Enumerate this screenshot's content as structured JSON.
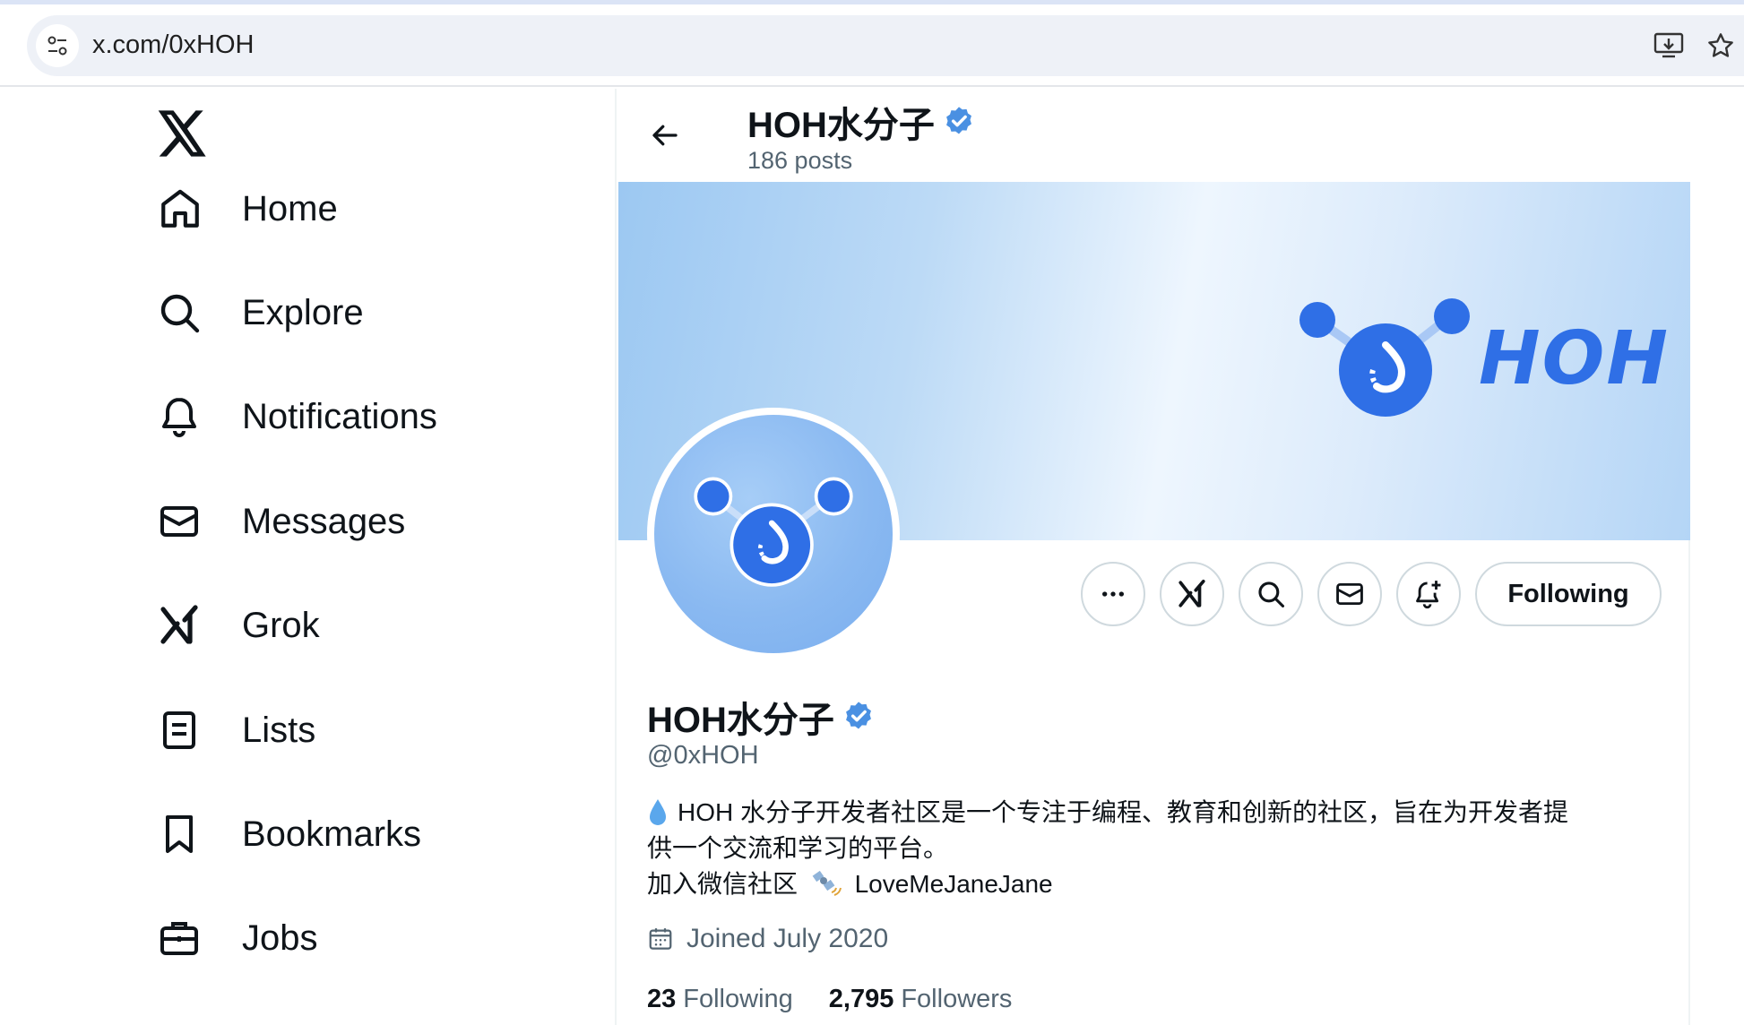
{
  "browser": {
    "url": "x.com/0xHOH"
  },
  "sidebar": {
    "items": [
      {
        "label": "Home",
        "icon": "home-icon"
      },
      {
        "label": "Explore",
        "icon": "search-icon"
      },
      {
        "label": "Notifications",
        "icon": "bell-icon"
      },
      {
        "label": "Messages",
        "icon": "mail-icon"
      },
      {
        "label": "Grok",
        "icon": "grok-icon"
      },
      {
        "label": "Lists",
        "icon": "list-icon"
      },
      {
        "label": "Bookmarks",
        "icon": "bookmark-icon"
      },
      {
        "label": "Jobs",
        "icon": "briefcase-icon"
      }
    ]
  },
  "header": {
    "name": "HOH水分子",
    "posts": "186 posts"
  },
  "banner": {
    "wordmark": "HOH"
  },
  "actions": {
    "following_label": "Following"
  },
  "profile": {
    "name": "HOH水分子",
    "handle": "@0xHOH",
    "bio_line1": "HOH 水分子开发者社区是一个专注于编程、教育和创新的社区，旨在为开发者提",
    "bio_line2": "供一个交流和学习的平台。",
    "bio_line3": "加入微信社区",
    "bio_line3_after": "LoveMeJaneJane",
    "joined": "Joined July 2020",
    "following_count": "23",
    "following_label": "Following",
    "followers_count": "2,795",
    "followers_label": "Followers"
  },
  "colors": {
    "accent": "#1d9bf0",
    "verified": "#4a90e2",
    "brand_blue": "#2f6fe6",
    "text_secondary": "#536471",
    "border": "#cfd9de"
  }
}
